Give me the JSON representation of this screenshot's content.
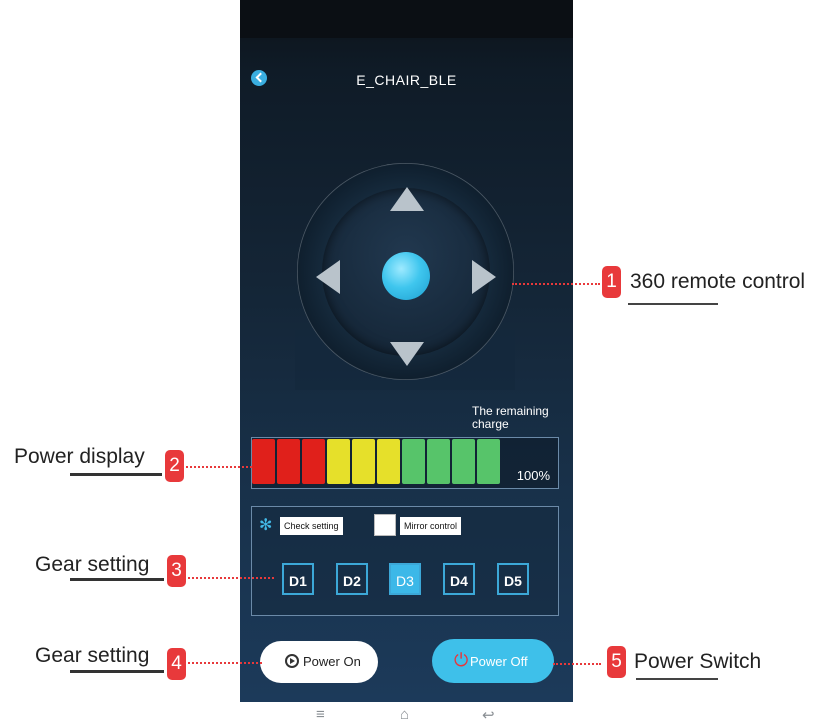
{
  "app": {
    "title": "E_CHAIR_BLE",
    "back_icon": "back-arrow-icon"
  },
  "joystick": {
    "up_icon": "arrow-up-icon",
    "down_icon": "arrow-down-icon",
    "left_icon": "arrow-left-icon",
    "right_icon": "arrow-right-icon",
    "center_icon": "joystick-knob"
  },
  "battery": {
    "label": "The remaining charge",
    "percent_text": "100%",
    "level": 1.0,
    "cells": [
      "#e0201b",
      "#e0201b",
      "#e0201b",
      "#e6e02a",
      "#e6e02a",
      "#e6e02a",
      "#57c46a",
      "#57c46a",
      "#57c46a",
      "#57c46a"
    ]
  },
  "settings": {
    "check_label": "Check setting",
    "check_icon": "fan-icon",
    "mirror_label": "Mirror control",
    "mirror_checked": false,
    "gears": [
      "D1",
      "D2",
      "D3",
      "D4",
      "D5"
    ],
    "active_gear": "D3"
  },
  "power": {
    "on_label": "Power On",
    "off_label": "Power Off",
    "on_icon": "play-circle-icon",
    "off_icon": "power-icon"
  },
  "android_nav": {
    "menu_icon": "menu-icon",
    "home_icon": "home-icon",
    "back_icon": "return-icon"
  },
  "callouts": [
    {
      "num": "1",
      "text": "360 remote control"
    },
    {
      "num": "2",
      "text": "Power display"
    },
    {
      "num": "3",
      "text": "Gear setting"
    },
    {
      "num": "4",
      "text": "Gear setting"
    },
    {
      "num": "5",
      "text": "Power Switch"
    }
  ],
  "colors": {
    "accent": "#3cb8e8",
    "callout": "#e8393b",
    "power_off_icon": "#e9363a"
  }
}
